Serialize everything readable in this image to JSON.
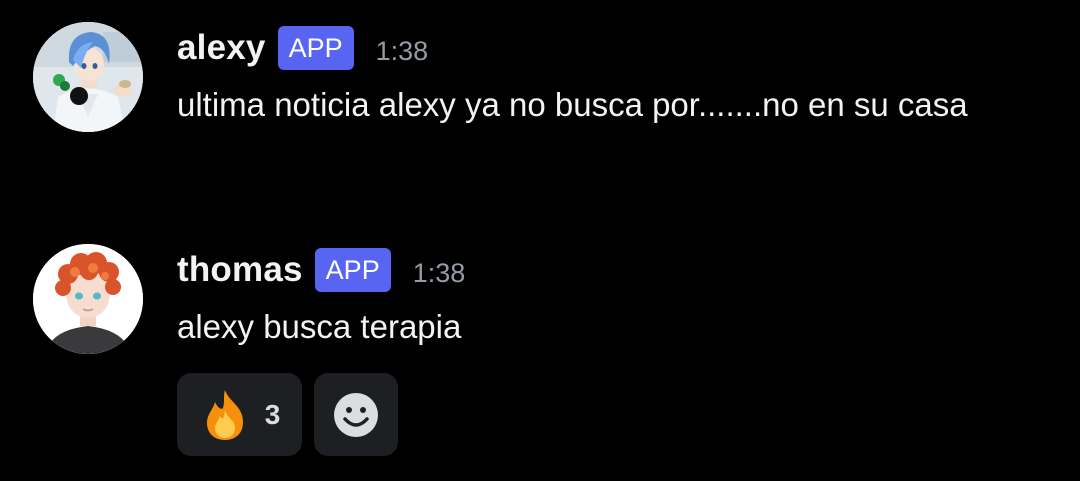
{
  "messages": [
    {
      "username": "alexy",
      "badge": "APP",
      "time": "1:38",
      "text": "ultima noticia alexy ya no busca por.......no en su casa",
      "avatar": "anime-boy-blue-hair-avatar"
    },
    {
      "username": "thomas",
      "badge": "APP",
      "time": "1:38",
      "text": "alexy busca terapia",
      "avatar": "redhead-boy-avatar",
      "reactions": [
        {
          "emoji": "fire-icon",
          "count": "3"
        },
        {
          "emoji": "add-reaction-icon"
        }
      ]
    }
  ],
  "colors": {
    "background": "#000000",
    "badge": "#5865f2",
    "reaction_bg": "#1e1f22",
    "timestamp": "#949ba4"
  }
}
